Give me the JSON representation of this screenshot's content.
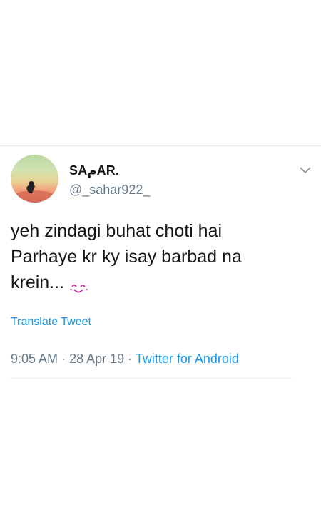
{
  "tweet": {
    "display_name": "SAمAR.",
    "handle": "@_sahar922_",
    "text_lines": [
      "yeh zindagi buhat choti hai",
      "Parhaye kr ky isay barbad na",
      "krein..."
    ],
    "translate_label": "Translate Tweet",
    "time": "9:05 AM",
    "separator": "·",
    "date": "28 Apr 19",
    "source": "Twitter for Android"
  },
  "icons": {
    "menu": "chevron-down-icon",
    "emoji": "smiling-face-emoji-icon"
  },
  "colors": {
    "text_primary": "#14171a",
    "text_secondary": "#657786",
    "link": "#1b95e0",
    "emoji": "#c043a7"
  }
}
